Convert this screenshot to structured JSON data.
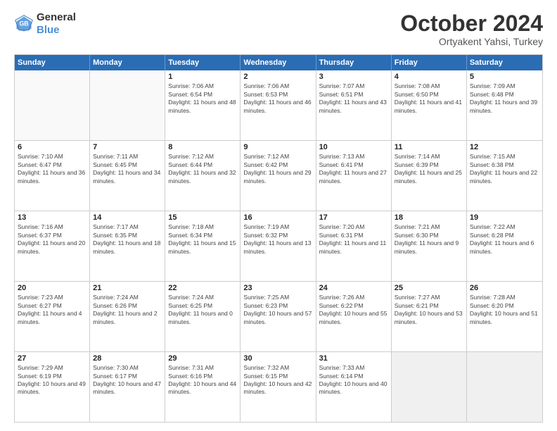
{
  "logo": {
    "line1": "General",
    "line2": "Blue"
  },
  "title": "October 2024",
  "subtitle": "Ortyakent Yahsi, Turkey",
  "header_days": [
    "Sunday",
    "Monday",
    "Tuesday",
    "Wednesday",
    "Thursday",
    "Friday",
    "Saturday"
  ],
  "rows": [
    [
      {
        "day": "",
        "text": "",
        "empty": true
      },
      {
        "day": "",
        "text": "",
        "empty": true
      },
      {
        "day": "1",
        "text": "Sunrise: 7:06 AM\nSunset: 6:54 PM\nDaylight: 11 hours and 48 minutes."
      },
      {
        "day": "2",
        "text": "Sunrise: 7:06 AM\nSunset: 6:53 PM\nDaylight: 11 hours and 46 minutes."
      },
      {
        "day": "3",
        "text": "Sunrise: 7:07 AM\nSunset: 6:51 PM\nDaylight: 11 hours and 43 minutes."
      },
      {
        "day": "4",
        "text": "Sunrise: 7:08 AM\nSunset: 6:50 PM\nDaylight: 11 hours and 41 minutes."
      },
      {
        "day": "5",
        "text": "Sunrise: 7:09 AM\nSunset: 6:48 PM\nDaylight: 11 hours and 39 minutes."
      }
    ],
    [
      {
        "day": "6",
        "text": "Sunrise: 7:10 AM\nSunset: 6:47 PM\nDaylight: 11 hours and 36 minutes."
      },
      {
        "day": "7",
        "text": "Sunrise: 7:11 AM\nSunset: 6:45 PM\nDaylight: 11 hours and 34 minutes."
      },
      {
        "day": "8",
        "text": "Sunrise: 7:12 AM\nSunset: 6:44 PM\nDaylight: 11 hours and 32 minutes."
      },
      {
        "day": "9",
        "text": "Sunrise: 7:12 AM\nSunset: 6:42 PM\nDaylight: 11 hours and 29 minutes."
      },
      {
        "day": "10",
        "text": "Sunrise: 7:13 AM\nSunset: 6:41 PM\nDaylight: 11 hours and 27 minutes."
      },
      {
        "day": "11",
        "text": "Sunrise: 7:14 AM\nSunset: 6:39 PM\nDaylight: 11 hours and 25 minutes."
      },
      {
        "day": "12",
        "text": "Sunrise: 7:15 AM\nSunset: 6:38 PM\nDaylight: 11 hours and 22 minutes."
      }
    ],
    [
      {
        "day": "13",
        "text": "Sunrise: 7:16 AM\nSunset: 6:37 PM\nDaylight: 11 hours and 20 minutes."
      },
      {
        "day": "14",
        "text": "Sunrise: 7:17 AM\nSunset: 6:35 PM\nDaylight: 11 hours and 18 minutes."
      },
      {
        "day": "15",
        "text": "Sunrise: 7:18 AM\nSunset: 6:34 PM\nDaylight: 11 hours and 15 minutes."
      },
      {
        "day": "16",
        "text": "Sunrise: 7:19 AM\nSunset: 6:32 PM\nDaylight: 11 hours and 13 minutes."
      },
      {
        "day": "17",
        "text": "Sunrise: 7:20 AM\nSunset: 6:31 PM\nDaylight: 11 hours and 11 minutes."
      },
      {
        "day": "18",
        "text": "Sunrise: 7:21 AM\nSunset: 6:30 PM\nDaylight: 11 hours and 9 minutes."
      },
      {
        "day": "19",
        "text": "Sunrise: 7:22 AM\nSunset: 6:28 PM\nDaylight: 11 hours and 6 minutes."
      }
    ],
    [
      {
        "day": "20",
        "text": "Sunrise: 7:23 AM\nSunset: 6:27 PM\nDaylight: 11 hours and 4 minutes."
      },
      {
        "day": "21",
        "text": "Sunrise: 7:24 AM\nSunset: 6:26 PM\nDaylight: 11 hours and 2 minutes."
      },
      {
        "day": "22",
        "text": "Sunrise: 7:24 AM\nSunset: 6:25 PM\nDaylight: 11 hours and 0 minutes."
      },
      {
        "day": "23",
        "text": "Sunrise: 7:25 AM\nSunset: 6:23 PM\nDaylight: 10 hours and 57 minutes."
      },
      {
        "day": "24",
        "text": "Sunrise: 7:26 AM\nSunset: 6:22 PM\nDaylight: 10 hours and 55 minutes."
      },
      {
        "day": "25",
        "text": "Sunrise: 7:27 AM\nSunset: 6:21 PM\nDaylight: 10 hours and 53 minutes."
      },
      {
        "day": "26",
        "text": "Sunrise: 7:28 AM\nSunset: 6:20 PM\nDaylight: 10 hours and 51 minutes."
      }
    ],
    [
      {
        "day": "27",
        "text": "Sunrise: 7:29 AM\nSunset: 6:19 PM\nDaylight: 10 hours and 49 minutes."
      },
      {
        "day": "28",
        "text": "Sunrise: 7:30 AM\nSunset: 6:17 PM\nDaylight: 10 hours and 47 minutes."
      },
      {
        "day": "29",
        "text": "Sunrise: 7:31 AM\nSunset: 6:16 PM\nDaylight: 10 hours and 44 minutes."
      },
      {
        "day": "30",
        "text": "Sunrise: 7:32 AM\nSunset: 6:15 PM\nDaylight: 10 hours and 42 minutes."
      },
      {
        "day": "31",
        "text": "Sunrise: 7:33 AM\nSunset: 6:14 PM\nDaylight: 10 hours and 40 minutes."
      },
      {
        "day": "",
        "text": "",
        "empty": true,
        "shaded": true
      },
      {
        "day": "",
        "text": "",
        "empty": true,
        "shaded": true
      }
    ]
  ]
}
